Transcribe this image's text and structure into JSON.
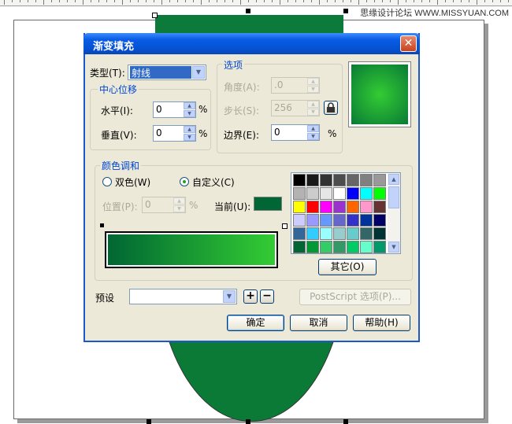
{
  "watermark": "思缘设计论坛 WWW.MISSYUAN.COM",
  "dialog": {
    "title": "渐变填充",
    "close_glyph": "✕",
    "type_label": "类型(T):",
    "type_value": "射线",
    "center_group": {
      "title": "中心位移",
      "horizontal_label": "水平(I):",
      "horizontal_value": "0",
      "vertical_label": "垂直(V):",
      "vertical_value": "0",
      "unit": "%"
    },
    "options_group": {
      "title": "选项",
      "angle_label": "角度(A):",
      "angle_value": ".0",
      "steps_label": "步长(S):",
      "steps_value": "256",
      "edge_label": "边界(E):",
      "edge_value": "0",
      "unit": "%"
    },
    "color_group": {
      "title": "颜色调和",
      "two_color_label": "双色(W)",
      "custom_label": "自定义(C)",
      "position_label": "位置(P):",
      "position_value": "0",
      "position_unit": "%",
      "current_label": "当前(U):",
      "current_color": "#006633",
      "other_button": "其它(O)"
    },
    "preset_label": "预设",
    "postscript_button": "PostScript 选项(P)...",
    "ok_button": "确定",
    "cancel_button": "取消",
    "help_button": "帮助(H)",
    "add_preset_glyph": "+",
    "remove_preset_glyph": "−"
  },
  "colors": {
    "gradient_start": "#006633",
    "gradient_end": "#33cc33",
    "preview_center": "#33cc33",
    "preview_edge": "#0a7a36",
    "accent": "#0046d5"
  },
  "palette": [
    "#000000",
    "#1a1a1a",
    "#333333",
    "#4d4d4d",
    "#666666",
    "#808080",
    "#999999",
    "#b3b3b3",
    "#cccccc",
    "#e6e6e6",
    "#ffffff",
    "#0000ff",
    "#00ffff",
    "#00ff00",
    "#ffff00",
    "#ff0000",
    "#ff00ff",
    "#9933cc",
    "#ff6600",
    "#ff99cc",
    "#663333",
    "#ccccff",
    "#9999ff",
    "#6699ff",
    "#6666cc",
    "#3333cc",
    "#003399",
    "#000066",
    "#336699",
    "#33ccff",
    "#99ffff",
    "#99cccc",
    "#66cccc",
    "#336666",
    "#003333",
    "#006633",
    "#009933",
    "#33cc66",
    "#339966",
    "#00cc66",
    "#66ffcc",
    "#00996b"
  ]
}
